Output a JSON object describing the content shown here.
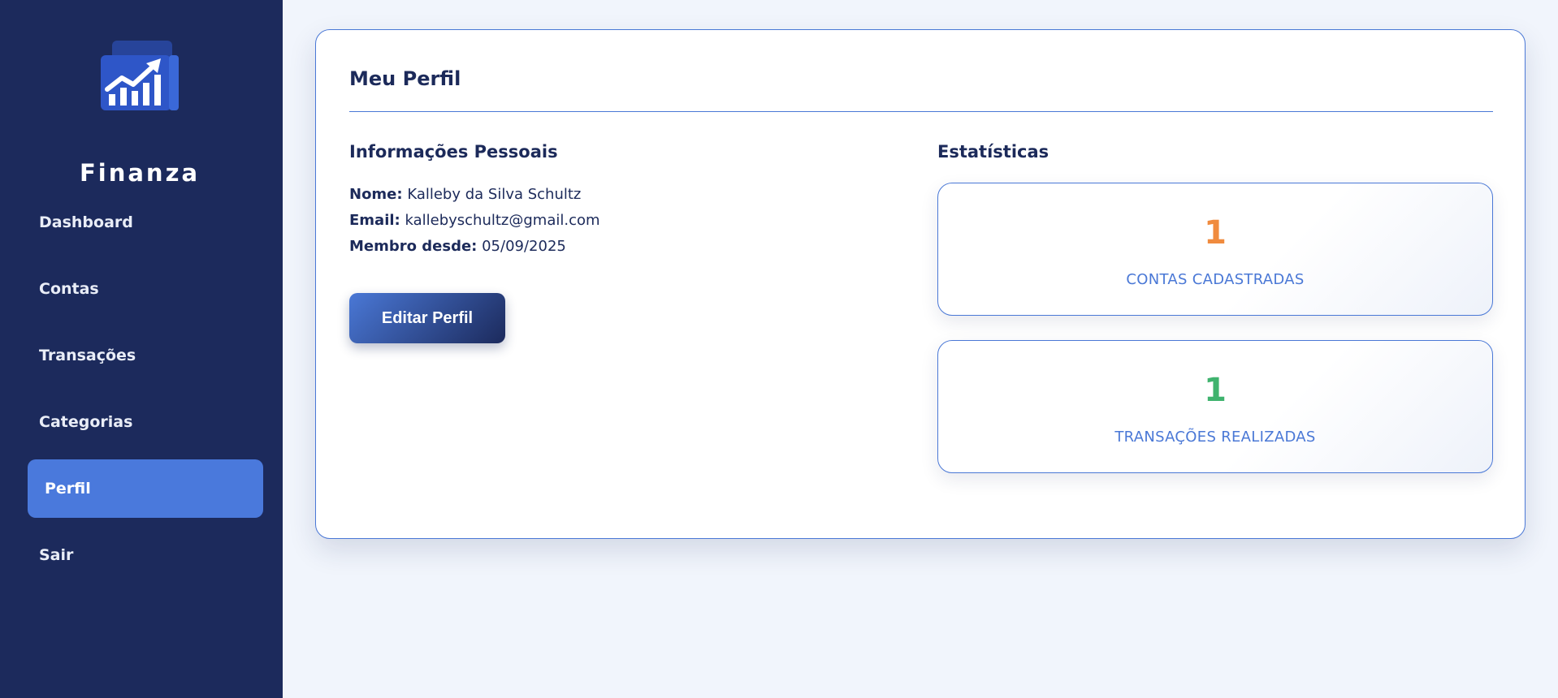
{
  "sidebar": {
    "brand": "Finanza",
    "logo_icon": "chart-growth-icon",
    "items": [
      {
        "label": "Dashboard",
        "active": false
      },
      {
        "label": "Contas",
        "active": false
      },
      {
        "label": "Transações",
        "active": false
      },
      {
        "label": "Categorias",
        "active": false
      },
      {
        "label": "Perfil",
        "active": true
      },
      {
        "label": "Sair",
        "active": false
      }
    ]
  },
  "profile": {
    "title": "Meu Perfil",
    "personal_title": "Informações Pessoais",
    "name_label": "Nome:",
    "name_value": "Kalleby da Silva Schultz",
    "email_label": "Email:",
    "email_value": "kallebyschultz@gmail.com",
    "member_label": "Membro desde:",
    "member_value": "05/09/2025",
    "edit_button": "Editar Perfil"
  },
  "stats": {
    "title": "Estatísticas",
    "accounts": {
      "value": "1",
      "label": "CONTAS CADASTRADAS",
      "color": "#f08b3e"
    },
    "transactions": {
      "value": "1",
      "label": "TRANSAÇÕES REALIZADAS",
      "color": "#3fb36e"
    }
  },
  "colors": {
    "sidebar_bg": "#1c2a5c",
    "accent": "#4a78d6",
    "page_bg": "#f1f5fc"
  }
}
